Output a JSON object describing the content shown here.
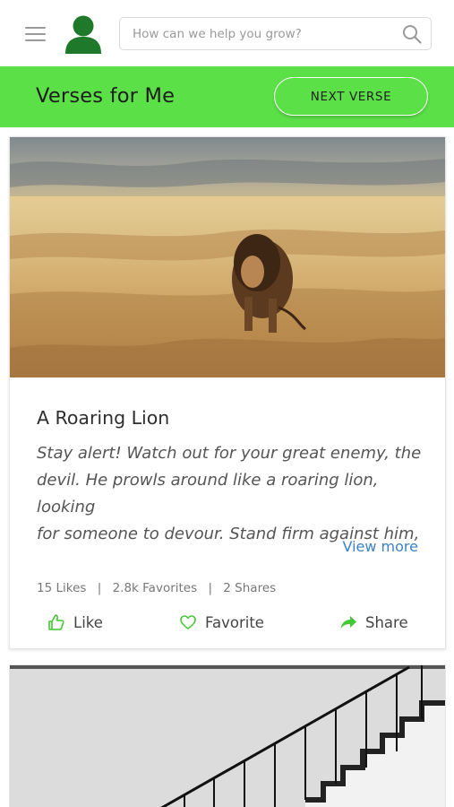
{
  "header": {
    "search_placeholder": "How can we help you grow?"
  },
  "banner": {
    "title": "Verses for Me",
    "next_button": "NEXT VERSE"
  },
  "colors": {
    "accent_green": "#5ce048",
    "avatar_green": "#1e7a2a",
    "link_blue": "#3b82c4"
  },
  "card": {
    "image": "lion-in-grassland-photo",
    "title": "A Roaring Lion",
    "verse_lines": [
      "Stay alert! Watch out for your great enemy, the",
      "devil. He prowls around like a roaring lion, looking",
      "for someone to devour. Stand firm against him,"
    ],
    "view_more": "View more",
    "stats": {
      "likes": "15 Likes",
      "favorites": "2.8k Favorites",
      "shares": "2 Shares",
      "separator": "|"
    },
    "actions": {
      "like": "Like",
      "favorite": "Favorite",
      "share": "Share"
    }
  },
  "next_card": {
    "image": "staircase-photo"
  },
  "icons": [
    "menu-icon",
    "user-avatar-icon",
    "search-icon",
    "thumbs-up-icon",
    "heart-icon",
    "share-arrow-icon"
  ]
}
